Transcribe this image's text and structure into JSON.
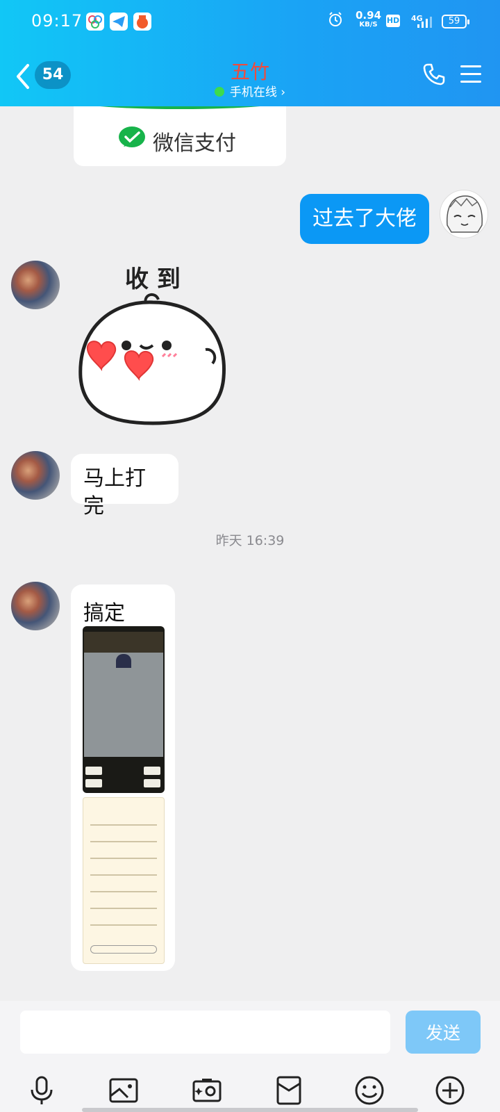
{
  "status_bar": {
    "time": "09:17",
    "net_speed_value": "0.94",
    "net_speed_unit": "KB/S",
    "hd_label": "HD",
    "network_label": "4G",
    "battery_level": "59"
  },
  "header": {
    "unread_count": "54",
    "title": "五竹",
    "subtitle": "手机在线 ›",
    "title_color": "#ef4b3d",
    "online_color": "#3ddb4d"
  },
  "messages": {
    "wechat_pay_label": "微信支付",
    "outgoing_1": "过去了大佬",
    "sticker_text": "收 到",
    "incoming_1": "马上打完",
    "timestamp": "昨天 16:39",
    "incoming_2": "搞定"
  },
  "input_bar": {
    "input_value": "",
    "send_label": "发送"
  },
  "colors": {
    "header_gradient_start": "#11c7f6",
    "header_gradient_end": "#2095f2",
    "outgoing_bubble": "#0b98f5",
    "send_button": "#7ec8f8",
    "wechat_green": "#17b34a"
  },
  "icons": [
    "back-chevron-icon",
    "phone-icon",
    "menu-icon",
    "microphone-icon",
    "image-icon",
    "camera-icon",
    "red-packet-icon",
    "emoji-icon",
    "plus-icon"
  ]
}
